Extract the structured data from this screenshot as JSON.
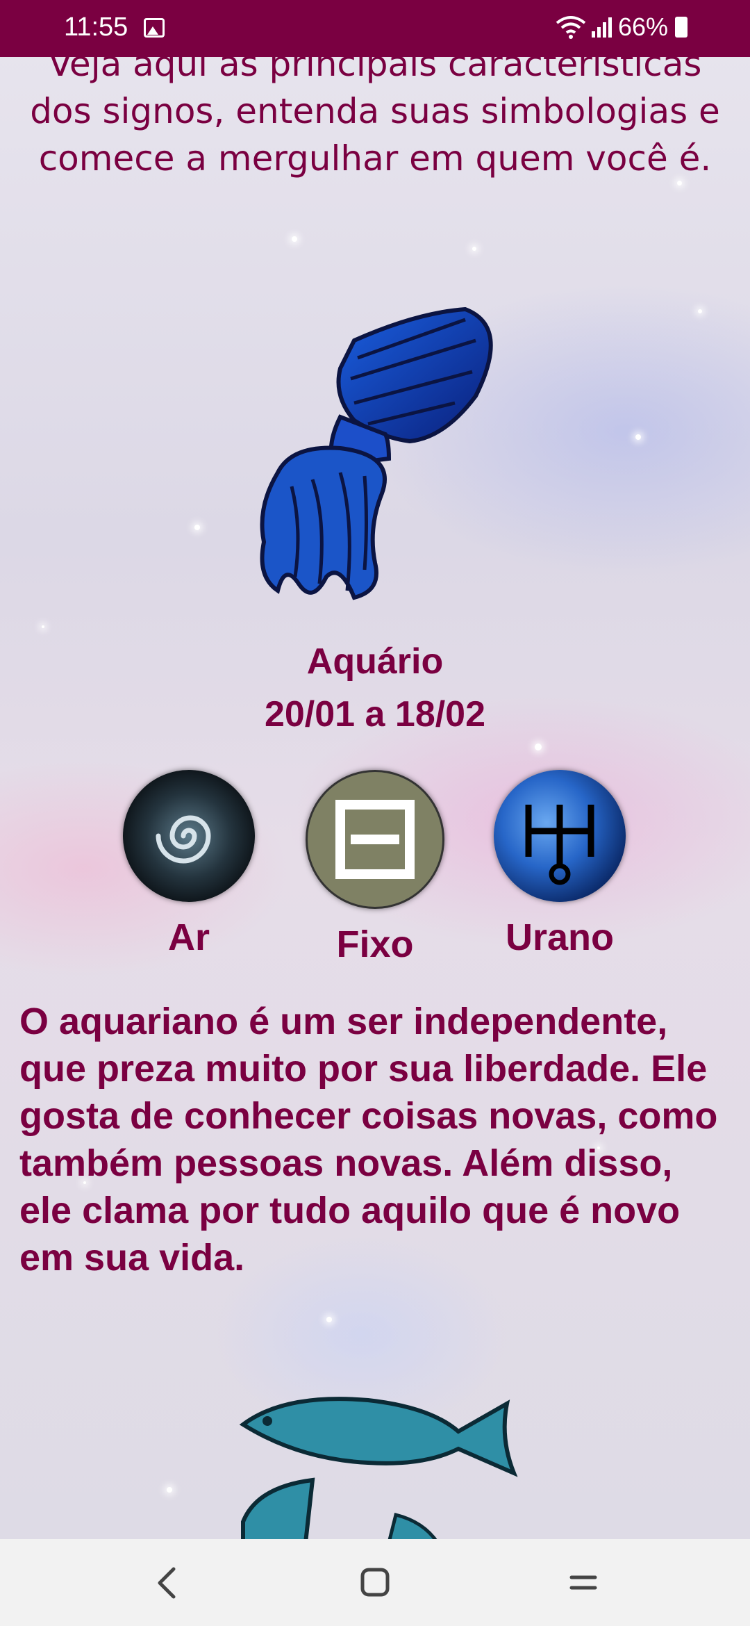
{
  "status_bar": {
    "time": "11:55",
    "battery": "66%"
  },
  "intro_text": "Veja aqui as principais características dos signos, entenda suas simbologias e comece a mergulhar em quem você é.",
  "sign": {
    "name": "Aquário",
    "dates": "20/01 a 18/02",
    "attributes": [
      {
        "label": "Ar",
        "icon": "air-element-icon"
      },
      {
        "label": "Fixo",
        "icon": "fixed-modality-icon"
      },
      {
        "label": "Urano",
        "icon": "uranus-planet-icon"
      }
    ],
    "description": "O aquariano é um ser independente, que preza muito por sua liberdade. Ele gosta de conhecer coisas novas, como também pessoas novas. Além disso, ele clama por tudo aquilo que é novo em sua vida."
  },
  "colors": {
    "accent": "#7a0041",
    "fixed_circle": "#7f8164"
  },
  "nav": {
    "back_icon": "back-icon",
    "home_icon": "home-icon",
    "recents_icon": "recents-icon"
  }
}
